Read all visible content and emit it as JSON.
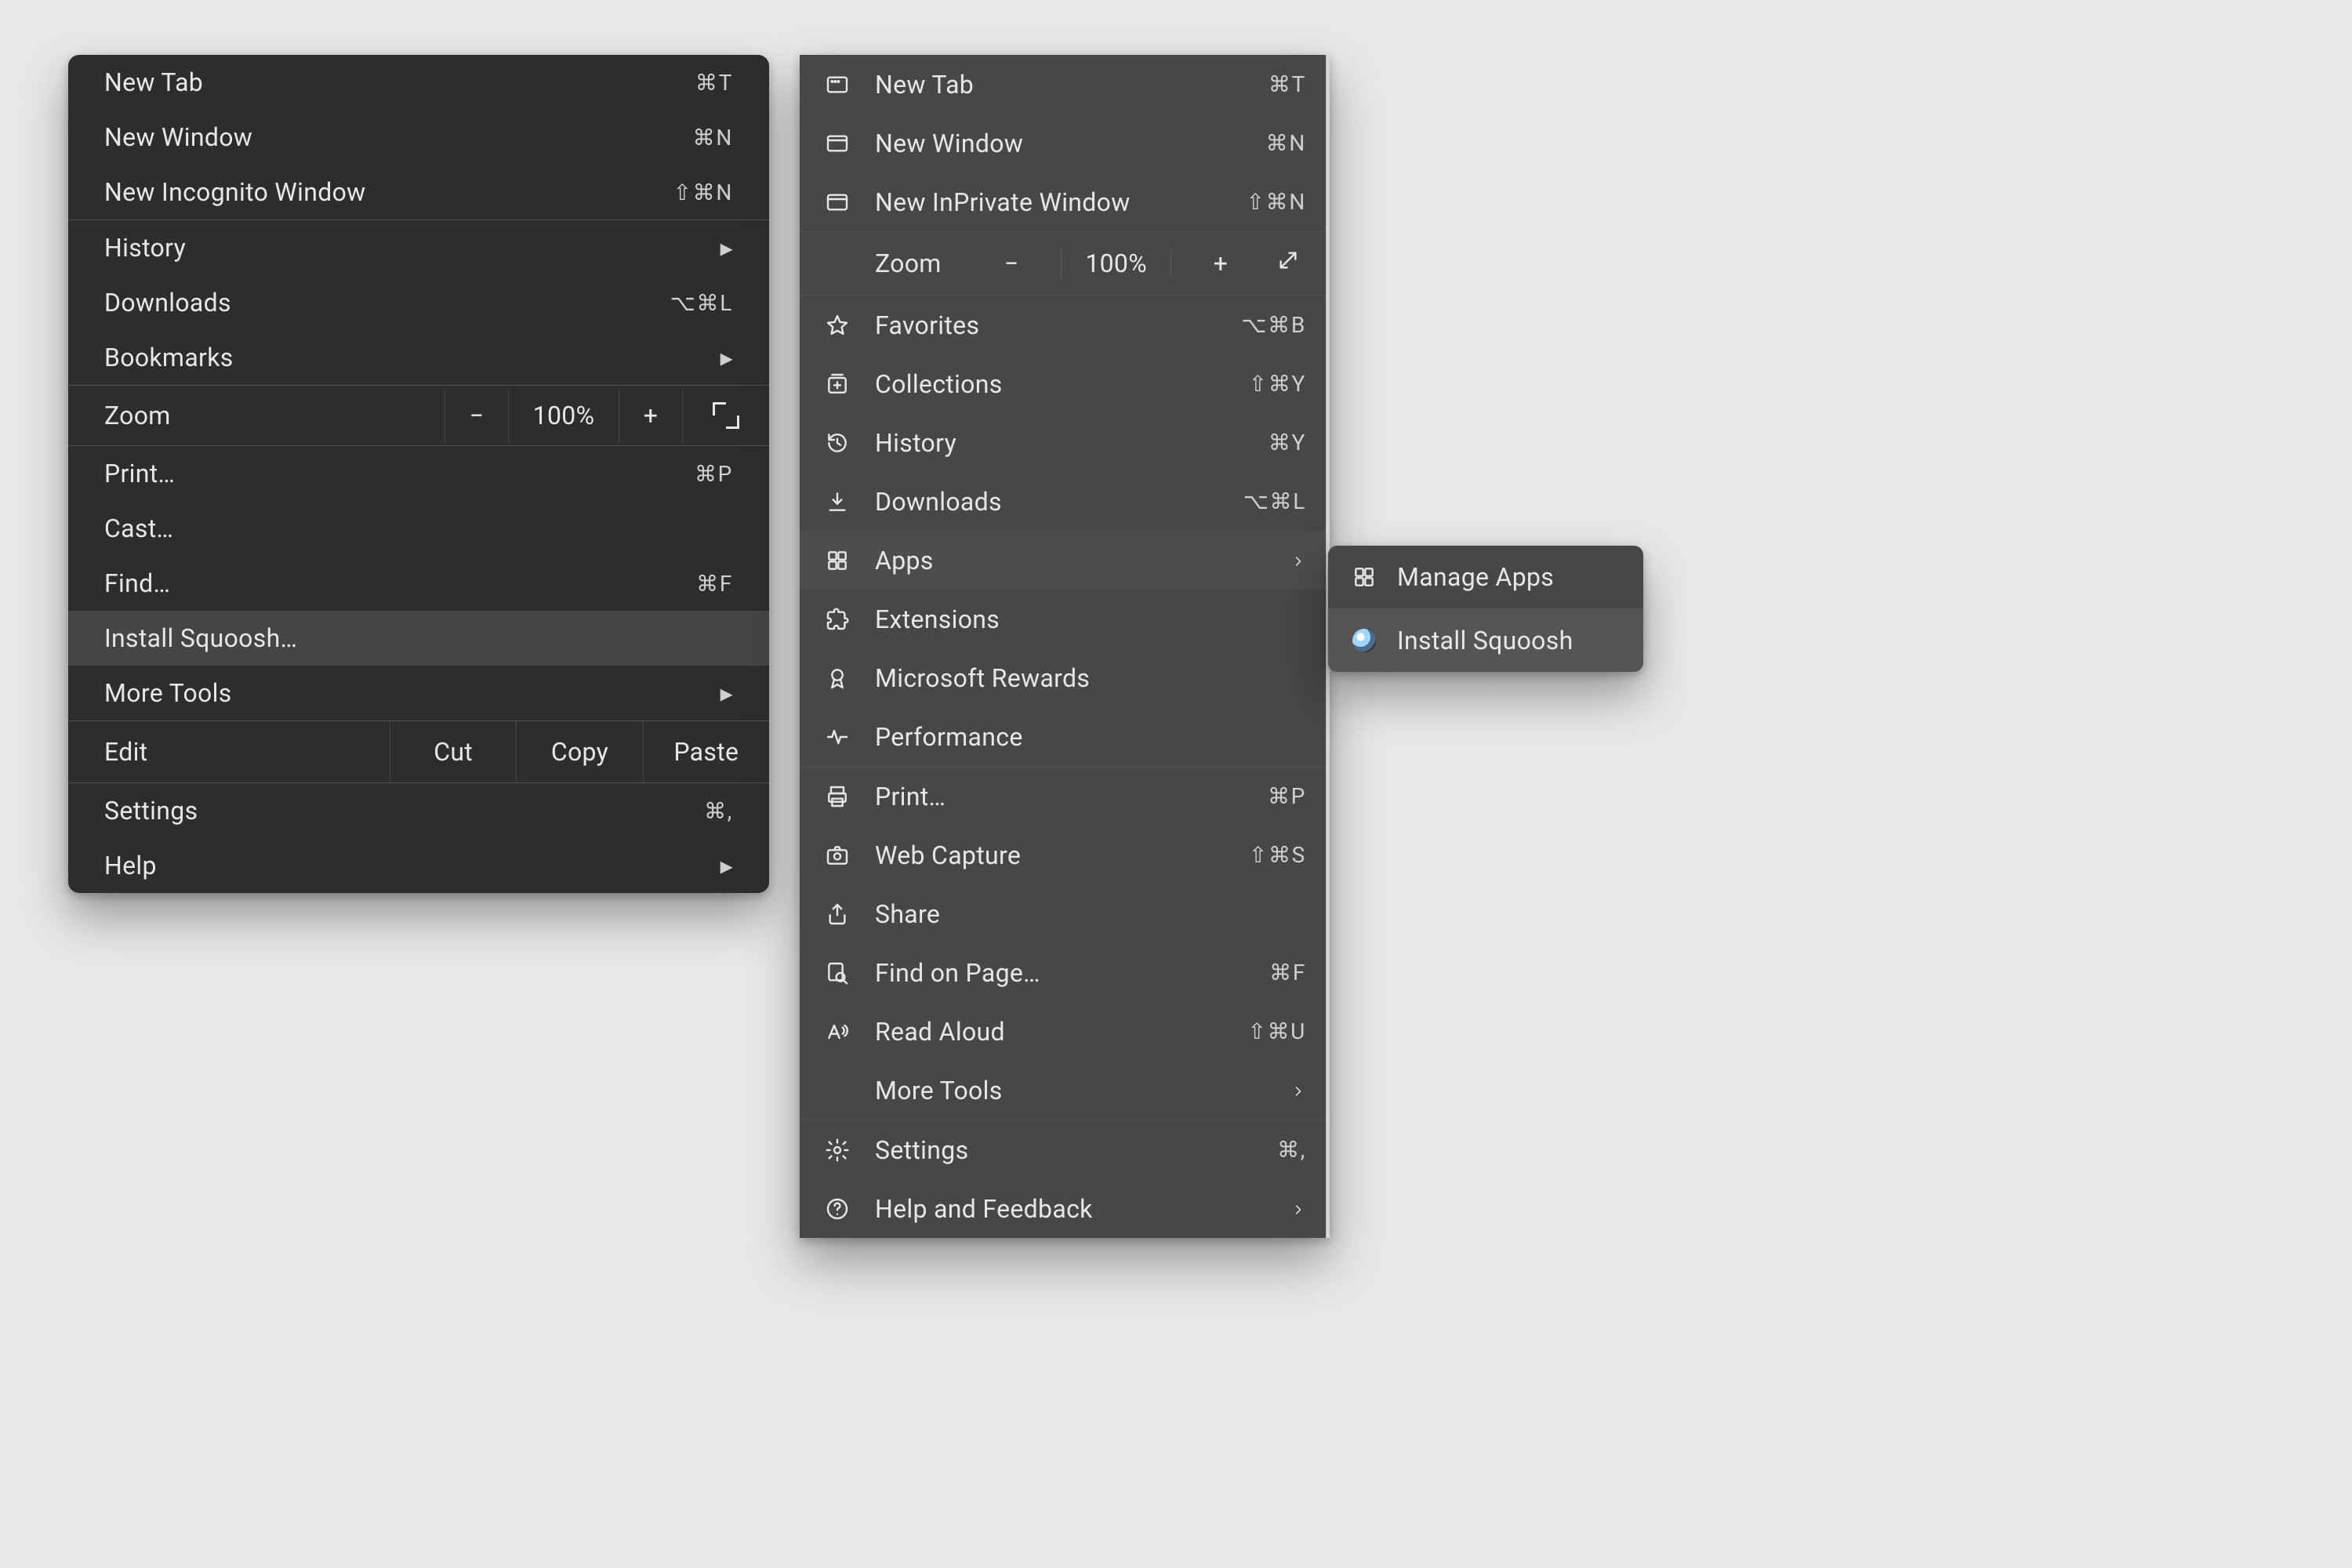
{
  "chrome": {
    "items1": [
      {
        "label": "New Tab",
        "shortcut": "⌘T"
      },
      {
        "label": "New Window",
        "shortcut": "⌘N"
      },
      {
        "label": "New Incognito Window",
        "shortcut": "⇧⌘N"
      }
    ],
    "items2": [
      {
        "label": "History",
        "arrow": true
      },
      {
        "label": "Downloads",
        "shortcut": "⌥⌘L"
      },
      {
        "label": "Bookmarks",
        "arrow": true
      }
    ],
    "zoom": {
      "label": "Zoom",
      "minus": "−",
      "value": "100%",
      "plus": "+"
    },
    "items3": [
      {
        "label": "Print…",
        "shortcut": "⌘P"
      },
      {
        "label": "Cast…"
      },
      {
        "label": "Find…",
        "shortcut": "⌘F"
      },
      {
        "label": "Install Squoosh…",
        "highlight": true
      },
      {
        "label": "More Tools",
        "arrow": true
      }
    ],
    "edit": {
      "label": "Edit",
      "cut": "Cut",
      "copy": "Copy",
      "paste": "Paste"
    },
    "items4": [
      {
        "label": "Settings",
        "shortcut": "⌘,"
      },
      {
        "label": "Help",
        "arrow": true
      }
    ]
  },
  "edge": {
    "items1": [
      {
        "icon": "new-tab",
        "label": "New Tab",
        "shortcut": "⌘T"
      },
      {
        "icon": "window",
        "label": "New Window",
        "shortcut": "⌘N"
      },
      {
        "icon": "window",
        "label": "New InPrivate Window",
        "shortcut": "⇧⌘N"
      }
    ],
    "zoom": {
      "label": "Zoom",
      "minus": "−",
      "value": "100%",
      "plus": "+"
    },
    "items2": [
      {
        "icon": "star",
        "label": "Favorites",
        "shortcut": "⌥⌘B"
      },
      {
        "icon": "collections",
        "label": "Collections",
        "shortcut": "⇧⌘Y"
      },
      {
        "icon": "history",
        "label": "History",
        "shortcut": "⌘Y"
      },
      {
        "icon": "download",
        "label": "Downloads",
        "shortcut": "⌥⌘L"
      },
      {
        "icon": "apps",
        "label": "Apps",
        "arrow": true,
        "highlight": true
      },
      {
        "icon": "extensions",
        "label": "Extensions"
      },
      {
        "icon": "rewards",
        "label": "Microsoft Rewards"
      },
      {
        "icon": "performance",
        "label": "Performance"
      }
    ],
    "items3": [
      {
        "icon": "print",
        "label": "Print…",
        "shortcut": "⌘P"
      },
      {
        "icon": "capture",
        "label": "Web Capture",
        "shortcut": "⇧⌘S"
      },
      {
        "icon": "share",
        "label": "Share"
      },
      {
        "icon": "find",
        "label": "Find on Page…",
        "shortcut": "⌘F"
      },
      {
        "icon": "read",
        "label": "Read Aloud",
        "shortcut": "⇧⌘U"
      },
      {
        "icon": "",
        "label": "More Tools",
        "arrow": true
      }
    ],
    "items4": [
      {
        "icon": "settings",
        "label": "Settings",
        "shortcut": "⌘,"
      },
      {
        "icon": "help",
        "label": "Help and Feedback",
        "arrow": true
      }
    ]
  },
  "submenu": {
    "items": [
      {
        "icon": "apps",
        "label": "Manage Apps"
      },
      {
        "icon": "squoosh",
        "label": "Install Squoosh",
        "highlight": true
      }
    ]
  }
}
